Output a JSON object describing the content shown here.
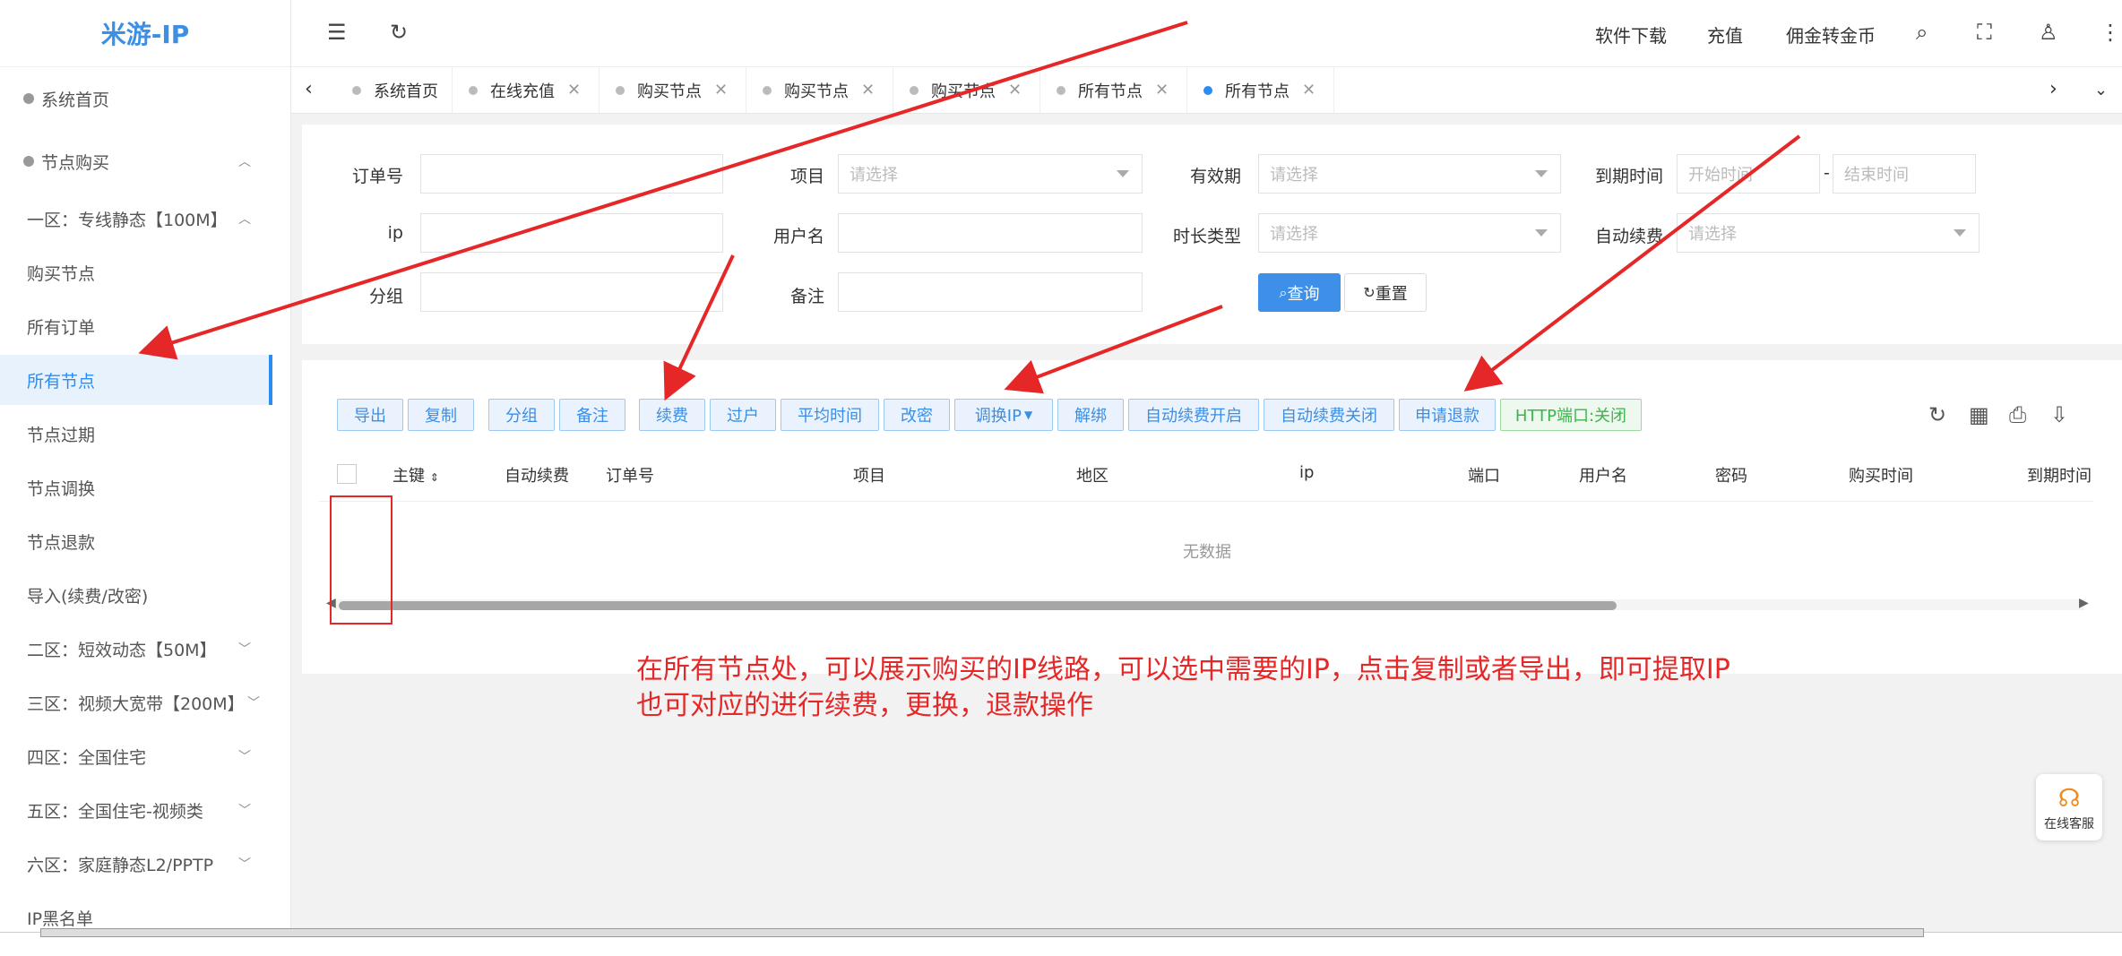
{
  "app": {
    "logo": "米游-IP"
  },
  "sidebar": {
    "items": [
      {
        "label": "系统首页"
      },
      {
        "label": "节点购买"
      },
      {
        "label": "一区：专线静态【100M】"
      },
      {
        "label": "购买节点"
      },
      {
        "label": "所有订单"
      },
      {
        "label": "所有节点"
      },
      {
        "label": "节点过期"
      },
      {
        "label": "节点调换"
      },
      {
        "label": "节点退款"
      },
      {
        "label": "导入(续费/改密)"
      },
      {
        "label": "二区：短效动态【50M】"
      },
      {
        "label": "三区：视频大宽带【200M】"
      },
      {
        "label": "四区：全国住宅"
      },
      {
        "label": "五区：全国住宅-视频类"
      },
      {
        "label": "六区：家庭静态L2/PPTP"
      },
      {
        "label": "IP黑名单"
      }
    ]
  },
  "header": {
    "links": [
      "软件下载",
      "充值",
      "佣金转金币"
    ]
  },
  "tabs": [
    {
      "label": "系统首页"
    },
    {
      "label": "在线充值"
    },
    {
      "label": "购买节点"
    },
    {
      "label": "购买节点"
    },
    {
      "label": "购买节点"
    },
    {
      "label": "所有节点"
    },
    {
      "label": "所有节点"
    }
  ],
  "filters": {
    "order_no_label": "订单号",
    "project_label": "项目",
    "project_placeholder": "请选择",
    "validity_label": "有效期",
    "validity_placeholder": "请选择",
    "expire_label": "到期时间",
    "start_placeholder": "开始时间",
    "range_sep": "-",
    "end_placeholder": "结束时间",
    "ip_label": "ip",
    "username_label": "用户名",
    "duration_label": "时长类型",
    "duration_placeholder": "请选择",
    "auto_renew_label": "自动续费",
    "auto_renew_placeholder": "请选择",
    "group_label": "分组",
    "remark_label": "备注",
    "query_btn": "查询",
    "reset_btn": "重置"
  },
  "toolbar": {
    "buttons": [
      "导出",
      "复制",
      "分组",
      "备注",
      "续费",
      "过户",
      "平均时间",
      "改密",
      "调换IP",
      "解绑",
      "自动续费开启",
      "自动续费关闭",
      "申请退款",
      "HTTP端口:关闭"
    ]
  },
  "table": {
    "columns": [
      "主键",
      "自动续费",
      "订单号",
      "项目",
      "地区",
      "ip",
      "端口",
      "用户名",
      "密码",
      "购买时间",
      "到期时间"
    ],
    "empty_text": "无数据"
  },
  "annotation": {
    "line1": "在所有节点处，可以展示购买的IP线路，可以选中需要的IP，点击复制或者导出，即可提取IP",
    "line2": "也可对应的进行续费，更换，退款操作",
    "color": "#e52727"
  },
  "support": {
    "label": "在线客服"
  }
}
